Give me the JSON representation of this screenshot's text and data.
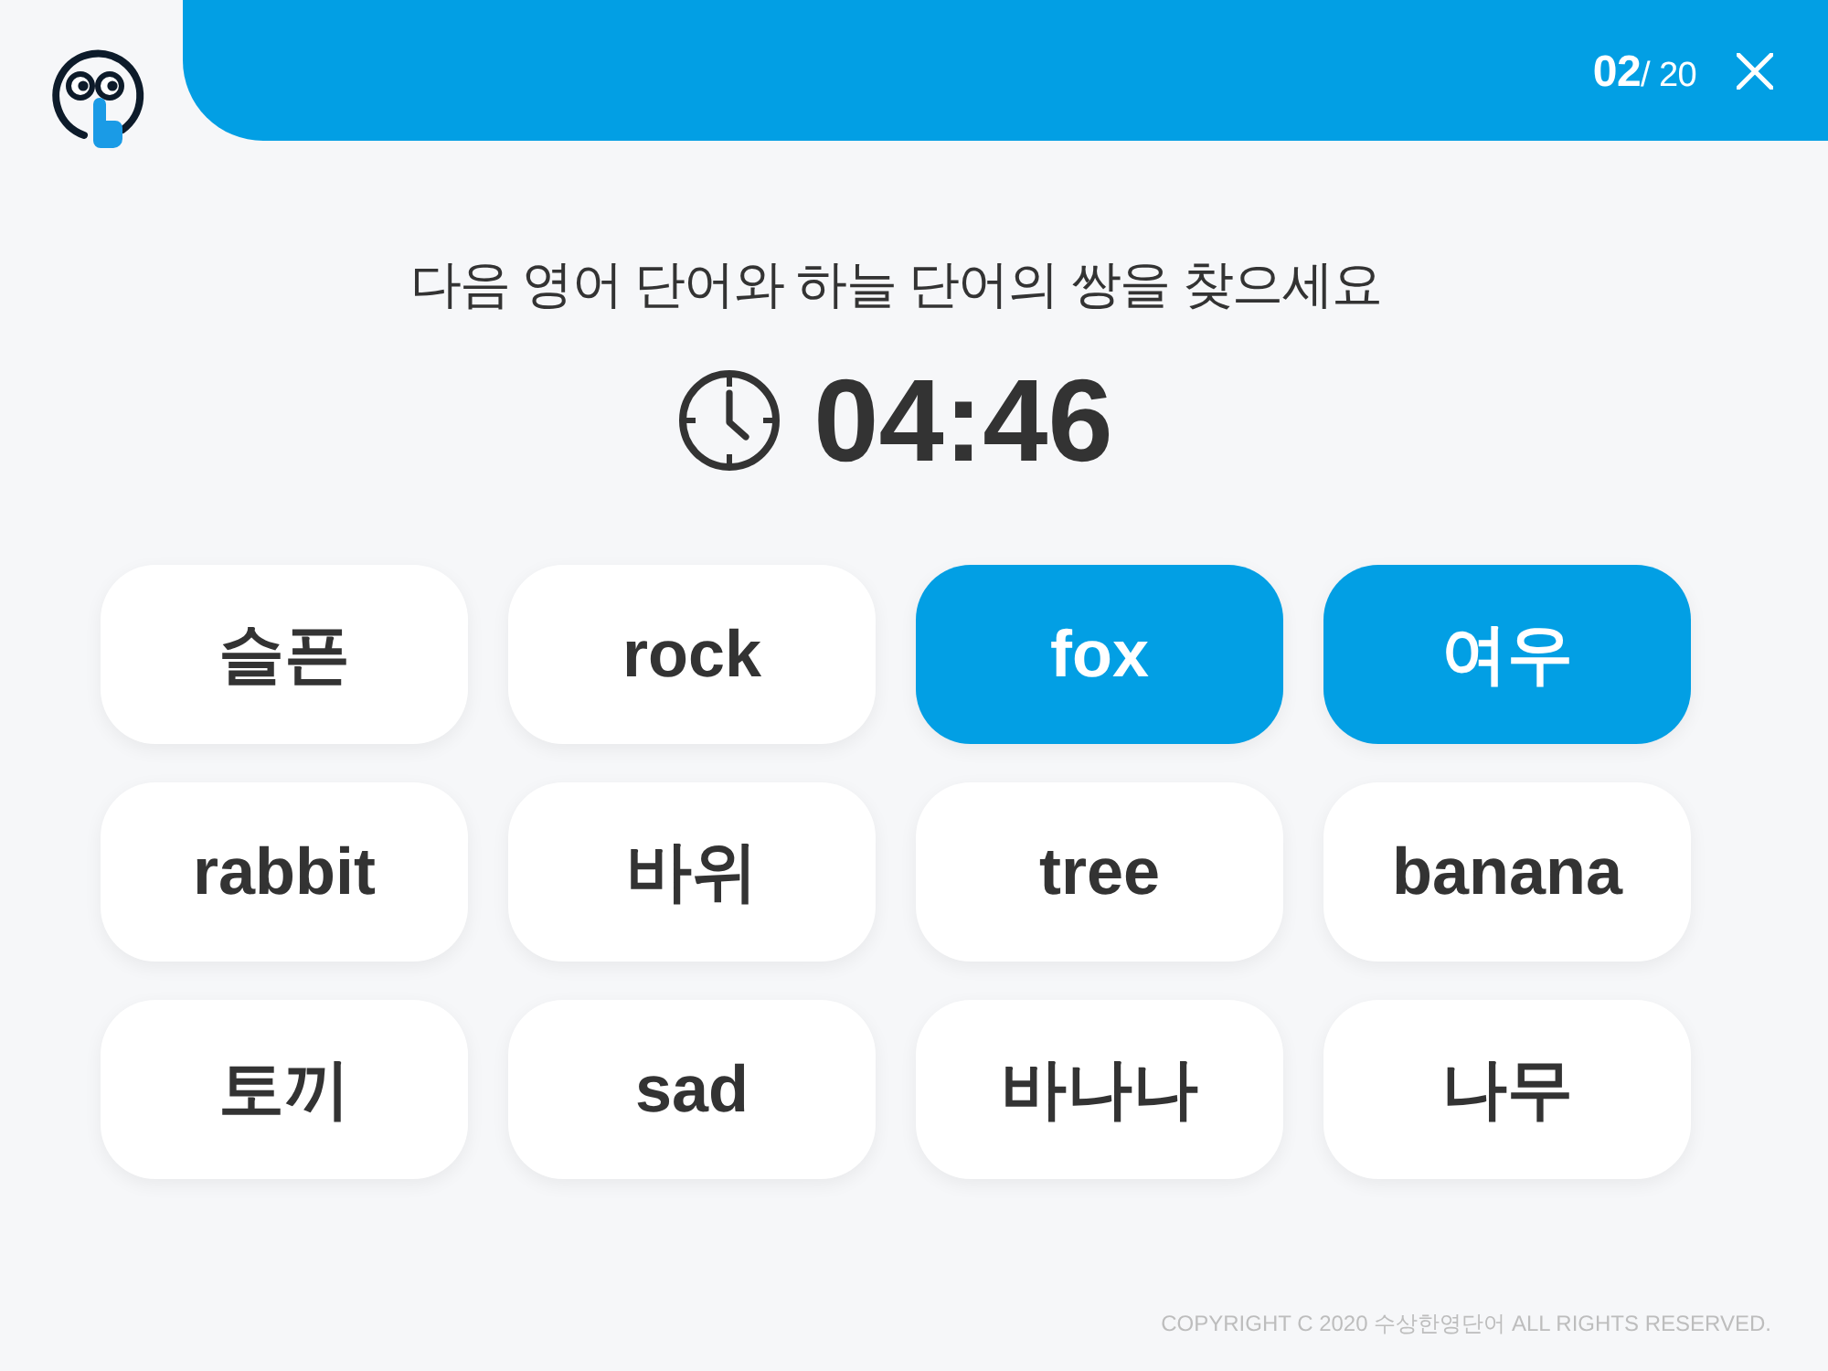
{
  "header": {
    "progress": "**02**/ 20"
  },
  "question": "다음 영어 단어와 하늘 단어의 쌍을 찾으세요",
  "timer": "04:46",
  "cards": [
    {
      "label": "슬픈",
      "selected": false
    },
    {
      "label": "rock",
      "selected": false
    },
    {
      "label": "fox",
      "selected": true
    },
    {
      "label": "여우",
      "selected": true
    },
    {
      "label": "rabbit",
      "selected": false
    },
    {
      "label": "바위",
      "selected": false
    },
    {
      "label": "tree",
      "selected": false
    },
    {
      "label": "banana",
      "selected": false
    },
    {
      "label": "토끼",
      "selected": false
    },
    {
      "label": "sad",
      "selected": false
    },
    {
      "label": "바나나",
      "selected": false
    },
    {
      "label": "나무",
      "selected": false
    }
  ],
  "footer": {
    "copyright": "COPYRIGHT C 2020 수상한영단어 ALL RIGHTS RESERVED."
  }
}
